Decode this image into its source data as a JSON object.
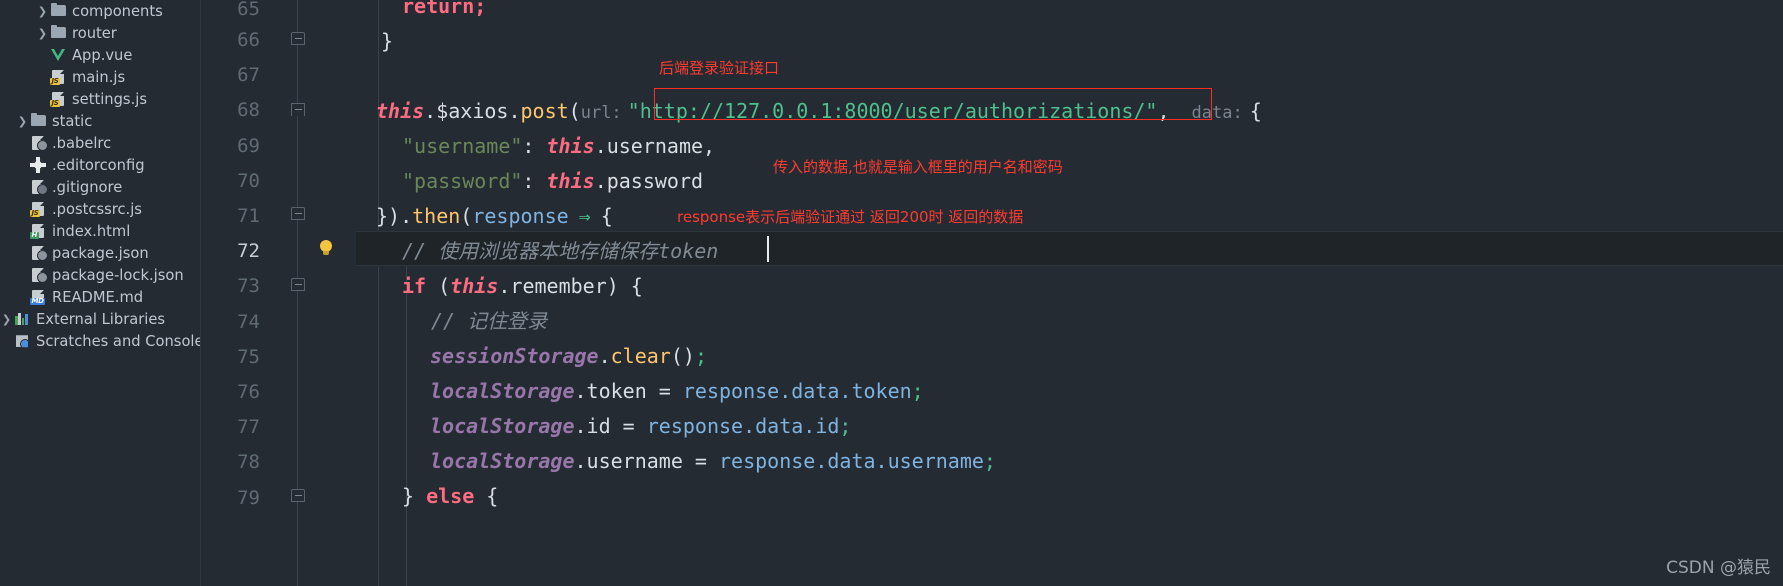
{
  "sidebar": {
    "items": [
      {
        "label": "components",
        "icon": "folder-icon",
        "arrow": "chevron-right-icon",
        "indent": 1
      },
      {
        "label": "router",
        "icon": "folder-icon",
        "arrow": "chevron-right-icon",
        "indent": 1
      },
      {
        "label": "App.vue",
        "icon": "vue-file-icon",
        "arrow": "",
        "indent": 2
      },
      {
        "label": "main.js",
        "icon": "js-file-icon",
        "arrow": "",
        "indent": 2
      },
      {
        "label": "settings.js",
        "icon": "js-file-icon",
        "arrow": "",
        "indent": 2
      },
      {
        "label": "static",
        "icon": "folder-icon",
        "arrow": "chevron-right-icon",
        "indent": 0
      },
      {
        "label": ".babelrc",
        "icon": "config-file-icon",
        "arrow": "",
        "indent": 1
      },
      {
        "label": ".editorconfig",
        "icon": "gear-icon",
        "arrow": "",
        "indent": 1
      },
      {
        "label": ".gitignore",
        "icon": "gitignore-file-icon",
        "arrow": "",
        "indent": 1
      },
      {
        "label": ".postcssrc.js",
        "icon": "js-file-icon",
        "arrow": "",
        "indent": 1
      },
      {
        "label": "index.html",
        "icon": "html-file-icon",
        "arrow": "",
        "indent": 1
      },
      {
        "label": "package.json",
        "icon": "config-file-icon",
        "arrow": "",
        "indent": 1
      },
      {
        "label": "package-lock.json",
        "icon": "config-file-icon",
        "arrow": "",
        "indent": 1
      },
      {
        "label": "README.md",
        "icon": "markdown-file-icon",
        "arrow": "",
        "indent": 1
      },
      {
        "label": "External Libraries",
        "icon": "libraries-icon",
        "arrow": "chevron-right-icon",
        "indent": 0
      },
      {
        "label": "Scratches and Consoles",
        "icon": "scratches-icon",
        "arrow": "",
        "indent": 0
      }
    ]
  },
  "gutter": {
    "line_numbers": [
      "65",
      "66",
      "67",
      "68",
      "69",
      "70",
      "71",
      "72",
      "73",
      "74",
      "75",
      "76",
      "77",
      "78",
      "79"
    ],
    "current_line": "72",
    "bulb_icon": "lightbulb-icon"
  },
  "editor": {
    "lines": {
      "l65": "return;",
      "l66": "}",
      "l68_a": "this",
      "l68_b": ".$axios.",
      "l68_c": "post",
      "l68_d": "(",
      "l68_param": "url:",
      "l68_url": "\"http://127.0.0.1:8000/user/authorizations/\"",
      "l68_comma": ",",
      "l68_data": "data:",
      "l68_brace": "{",
      "l69_key": "\"username\"",
      "l69_colon": ": ",
      "l69_this": "this",
      "l69_val": ".username,",
      "l70_key": "\"password\"",
      "l70_colon": ": ",
      "l70_this": "this",
      "l70_val": ".password",
      "l71_a": "}).",
      "l71_then": "then",
      "l71_b": "(",
      "l71_resp": "response",
      "l71_arrow": "⇒",
      "l71_brace": "{",
      "l72_comment": "// 使用浏览器本地存储保存token",
      "l73_if": "if",
      "l73_a": " (",
      "l73_this": "this",
      "l73_b": ".remember) {",
      "l74_comment": "// 记住登录",
      "l75_obj": "sessionStorage",
      "l75_dot": ".",
      "l75_fn": "clear",
      "l75_args": "()",
      "l75_semi": ";",
      "l76_obj": "localStorage",
      "l76_prop": ".token ",
      "l76_eq": "= ",
      "l76_val": "response.data.token",
      "l76_semi": ";",
      "l77_obj": "localStorage",
      "l77_prop": ".id ",
      "l77_eq": "= ",
      "l77_val": "response.data.id",
      "l77_semi": ";",
      "l78_obj": "localStorage",
      "l78_prop": ".username ",
      "l78_eq": "= ",
      "l78_val": "response.data.username",
      "l78_semi": ";",
      "l79_a": "} ",
      "l79_else": "else",
      "l79_b": " {"
    }
  },
  "annotations": {
    "api_note": "后端登录验证接口",
    "data_note": "传入的数据,也就是输入框里的用户名和密码",
    "response_note": "response表示后端验证通过 返回200时 返回的数据"
  },
  "watermark": {
    "text": "CSDN @猿民"
  },
  "colors": {
    "background": "#252b33",
    "annotation_red": "#ff3b30",
    "string_green": "#4fc08d",
    "keyword_pink": "#ff6b81",
    "function_orange": "#ffc66d",
    "comment_gray": "#808a94",
    "storage_purple": "#9876aa",
    "object_blue": "#7fb3e0",
    "current_line_bg": "#1f2429"
  }
}
